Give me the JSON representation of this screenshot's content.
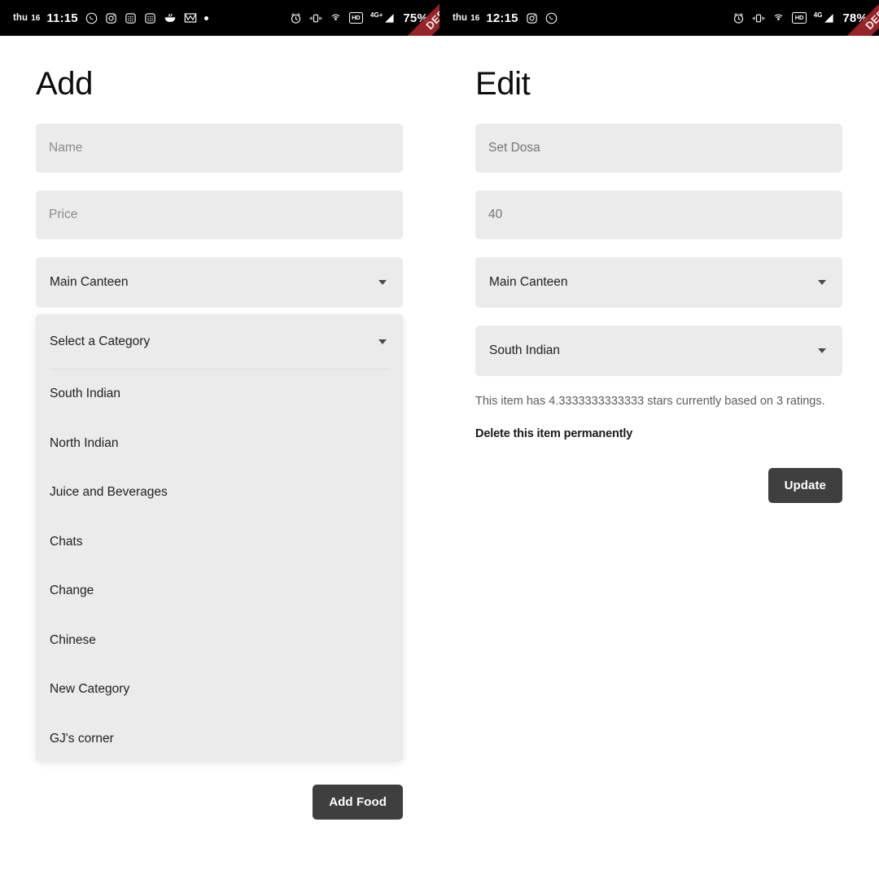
{
  "screens": [
    {
      "statusbar": {
        "day": "thu",
        "date": "16",
        "time": "11:15",
        "battery": "75%",
        "network": "4G+",
        "hd": "HD",
        "debug_label": "DEBUG",
        "left_icons": [
          "whatsapp-icon",
          "instagram-icon",
          "calculator-icon",
          "calculator-icon",
          "food-bowl-icon",
          "gmail-icon",
          "dot-icon"
        ],
        "right_icons": [
          "alarm-icon",
          "vibrate-icon",
          "hotspot-icon",
          "hd-icon",
          "signal-icon"
        ]
      },
      "title": "Add",
      "fields": [
        {
          "placeholder": "Name",
          "value": ""
        },
        {
          "placeholder": "Price",
          "value": ""
        }
      ],
      "canteen_select": "Main Canteen",
      "category_select": "Select a Category",
      "category_options": [
        "South Indian",
        "North Indian",
        "Juice and Beverages",
        "Chats",
        "Change",
        "Chinese",
        "New Category",
        "GJ's corner"
      ],
      "submit_label": "Add Food"
    },
    {
      "statusbar": {
        "day": "thu",
        "date": "16",
        "time": "12:15",
        "battery": "78%",
        "network": "4G",
        "hd": "HD",
        "debug_label": "DEBUG",
        "left_icons": [
          "instagram-icon",
          "whatsapp-icon"
        ],
        "right_icons": [
          "alarm-icon",
          "vibrate-icon",
          "hotspot-icon",
          "hd-icon",
          "signal-icon"
        ]
      },
      "title": "Edit",
      "fields": [
        {
          "placeholder": "Set Dosa",
          "value": "Set Dosa"
        },
        {
          "placeholder": "40",
          "value": "40"
        }
      ],
      "canteen_select": "Main Canteen",
      "category_select": "South Indian",
      "rating_text": "This item has 4.3333333333333 stars currently based on 3 ratings.",
      "delete_label": "Delete this item permanently",
      "submit_label": "Update"
    }
  ],
  "colors": {
    "field_bg": "#ebebeb",
    "button_bg": "#3f3f3f",
    "debug_ribbon": "#a1262c",
    "status_bar_bg": "#000000",
    "page_bg": "#ffffff"
  }
}
